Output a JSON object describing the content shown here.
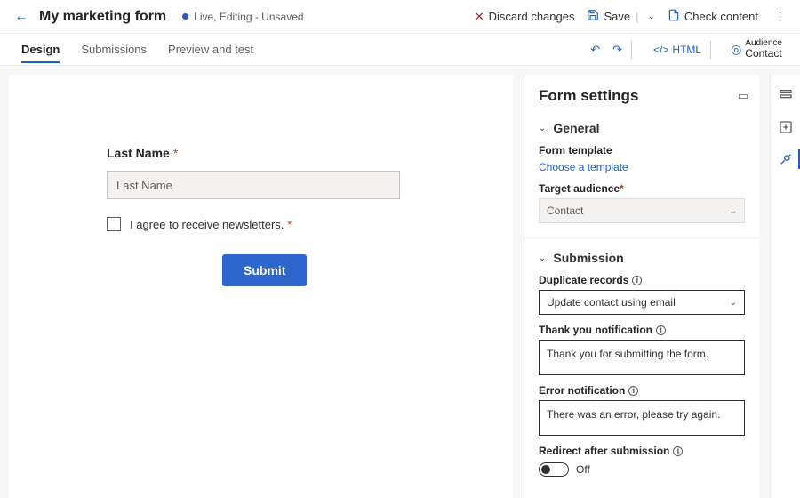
{
  "header": {
    "title": "My marketing form",
    "status": "Live, Editing - Unsaved",
    "discard": "Discard changes",
    "save": "Save",
    "check": "Check content"
  },
  "tabs": {
    "design": "Design",
    "submissions": "Submissions",
    "preview": "Preview and test"
  },
  "right_actions": {
    "html": "HTML",
    "audience_label": "Audience",
    "audience_value": "Contact"
  },
  "form_preview": {
    "last_name_label": "Last Name",
    "last_name_placeholder": "Last Name",
    "consent_text": "I agree to receive newsletters.",
    "submit": "Submit"
  },
  "settings": {
    "panel_title": "Form settings",
    "general": {
      "title": "General",
      "template_label": "Form template",
      "template_link": "Choose a template",
      "audience_label": "Target audience",
      "audience_value": "Contact"
    },
    "submission": {
      "title": "Submission",
      "duplicate_label": "Duplicate records",
      "duplicate_value": "Update contact using email",
      "thankyou_label": "Thank you notification",
      "thankyou_value": "Thank you for submitting the form.",
      "error_label": "Error notification",
      "error_value": "There was an error, please try again.",
      "redirect_label": "Redirect after submission",
      "redirect_value": "Off"
    }
  }
}
